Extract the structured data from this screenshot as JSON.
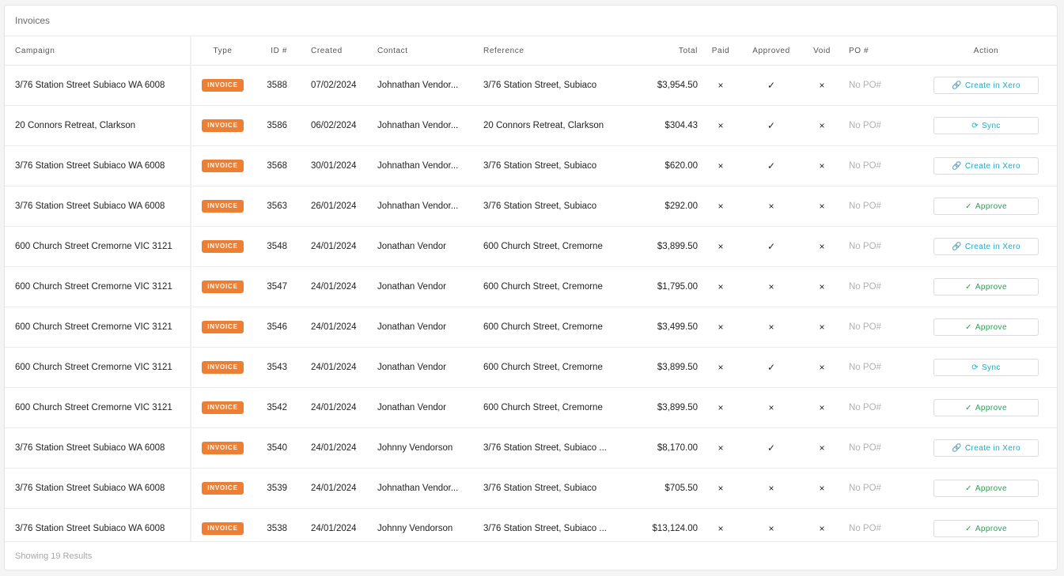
{
  "card": {
    "title": "Invoices"
  },
  "columns": {
    "campaign": "Campaign",
    "type": "Type",
    "id": "ID #",
    "created": "Created",
    "contact": "Contact",
    "reference": "Reference",
    "total": "Total",
    "paid": "Paid",
    "approved": "Approved",
    "void": "Void",
    "po": "PO #",
    "action": "Action"
  },
  "icons": {
    "x": "×",
    "check": "✓",
    "link-icon": "🔗",
    "sync-icon": "⟳",
    "check-icon": "✓"
  },
  "colors": {
    "badge": "#ec7f33",
    "xero": "#1aa9c9",
    "approve": "#2f9a55"
  },
  "rows": [
    {
      "campaign": "3/76 Station Street Subiaco WA 6008",
      "type": "INVOICE",
      "id": "3588",
      "created": "07/02/2024",
      "contact": "Johnathan Vendor...",
      "reference": "3/76 Station Street, Subiaco",
      "total": "$3,954.50",
      "paid": "×",
      "approved": "✓",
      "void": "×",
      "po": "No PO#",
      "action": {
        "kind": "xero",
        "label": "Create in Xero"
      }
    },
    {
      "campaign": "20 Connors Retreat, Clarkson",
      "type": "INVOICE",
      "id": "3586",
      "created": "06/02/2024",
      "contact": "Johnathan Vendor...",
      "reference": "20 Connors Retreat, Clarkson",
      "total": "$304.43",
      "paid": "×",
      "approved": "✓",
      "void": "×",
      "po": "No PO#",
      "action": {
        "kind": "sync",
        "label": "Sync"
      }
    },
    {
      "campaign": "3/76 Station Street Subiaco WA 6008",
      "type": "INVOICE",
      "id": "3568",
      "created": "30/01/2024",
      "contact": "Johnathan Vendor...",
      "reference": "3/76 Station Street, Subiaco",
      "total": "$620.00",
      "paid": "×",
      "approved": "✓",
      "void": "×",
      "po": "No PO#",
      "action": {
        "kind": "xero",
        "label": "Create in Xero"
      }
    },
    {
      "campaign": "3/76 Station Street Subiaco WA 6008",
      "type": "INVOICE",
      "id": "3563",
      "created": "26/01/2024",
      "contact": "Johnathan Vendor...",
      "reference": "3/76 Station Street, Subiaco",
      "total": "$292.00",
      "paid": "×",
      "approved": "×",
      "void": "×",
      "po": "No PO#",
      "action": {
        "kind": "approve",
        "label": "Approve"
      }
    },
    {
      "campaign": "600 Church Street Cremorne VIC 3121",
      "type": "INVOICE",
      "id": "3548",
      "created": "24/01/2024",
      "contact": "Jonathan Vendor",
      "reference": "600 Church Street, Cremorne",
      "total": "$3,899.50",
      "paid": "×",
      "approved": "✓",
      "void": "×",
      "po": "No PO#",
      "action": {
        "kind": "xero",
        "label": "Create in Xero"
      }
    },
    {
      "campaign": "600 Church Street Cremorne VIC 3121",
      "type": "INVOICE",
      "id": "3547",
      "created": "24/01/2024",
      "contact": "Jonathan Vendor",
      "reference": "600 Church Street, Cremorne",
      "total": "$1,795.00",
      "paid": "×",
      "approved": "×",
      "void": "×",
      "po": "No PO#",
      "action": {
        "kind": "approve",
        "label": "Approve"
      }
    },
    {
      "campaign": "600 Church Street Cremorne VIC 3121",
      "type": "INVOICE",
      "id": "3546",
      "created": "24/01/2024",
      "contact": "Jonathan Vendor",
      "reference": "600 Church Street, Cremorne",
      "total": "$3,499.50",
      "paid": "×",
      "approved": "×",
      "void": "×",
      "po": "No PO#",
      "action": {
        "kind": "approve",
        "label": "Approve"
      }
    },
    {
      "campaign": "600 Church Street Cremorne VIC 3121",
      "type": "INVOICE",
      "id": "3543",
      "created": "24/01/2024",
      "contact": "Jonathan Vendor",
      "reference": "600 Church Street, Cremorne",
      "total": "$3,899.50",
      "paid": "×",
      "approved": "✓",
      "void": "×",
      "po": "No PO#",
      "action": {
        "kind": "sync",
        "label": "Sync"
      }
    },
    {
      "campaign": "600 Church Street Cremorne VIC 3121",
      "type": "INVOICE",
      "id": "3542",
      "created": "24/01/2024",
      "contact": "Jonathan Vendor",
      "reference": "600 Church Street, Cremorne",
      "total": "$3,899.50",
      "paid": "×",
      "approved": "×",
      "void": "×",
      "po": "No PO#",
      "action": {
        "kind": "approve",
        "label": "Approve"
      }
    },
    {
      "campaign": "3/76 Station Street Subiaco WA 6008",
      "type": "INVOICE",
      "id": "3540",
      "created": "24/01/2024",
      "contact": "Johnny Vendorson",
      "reference": "3/76 Station Street, Subiaco ...",
      "total": "$8,170.00",
      "paid": "×",
      "approved": "✓",
      "void": "×",
      "po": "No PO#",
      "action": {
        "kind": "xero",
        "label": "Create in Xero"
      }
    },
    {
      "campaign": "3/76 Station Street Subiaco WA 6008",
      "type": "INVOICE",
      "id": "3539",
      "created": "24/01/2024",
      "contact": "Johnathan Vendor...",
      "reference": "3/76 Station Street, Subiaco",
      "total": "$705.50",
      "paid": "×",
      "approved": "×",
      "void": "×",
      "po": "No PO#",
      "action": {
        "kind": "approve",
        "label": "Approve"
      }
    },
    {
      "campaign": "3/76 Station Street Subiaco WA 6008",
      "type": "INVOICE",
      "id": "3538",
      "created": "24/01/2024",
      "contact": "Johnny Vendorson",
      "reference": "3/76 Station Street, Subiaco ...",
      "total": "$13,124.00",
      "paid": "×",
      "approved": "×",
      "void": "×",
      "po": "No PO#",
      "action": {
        "kind": "approve",
        "label": "Approve"
      }
    }
  ],
  "footer": {
    "results": "Showing 19 Results"
  }
}
